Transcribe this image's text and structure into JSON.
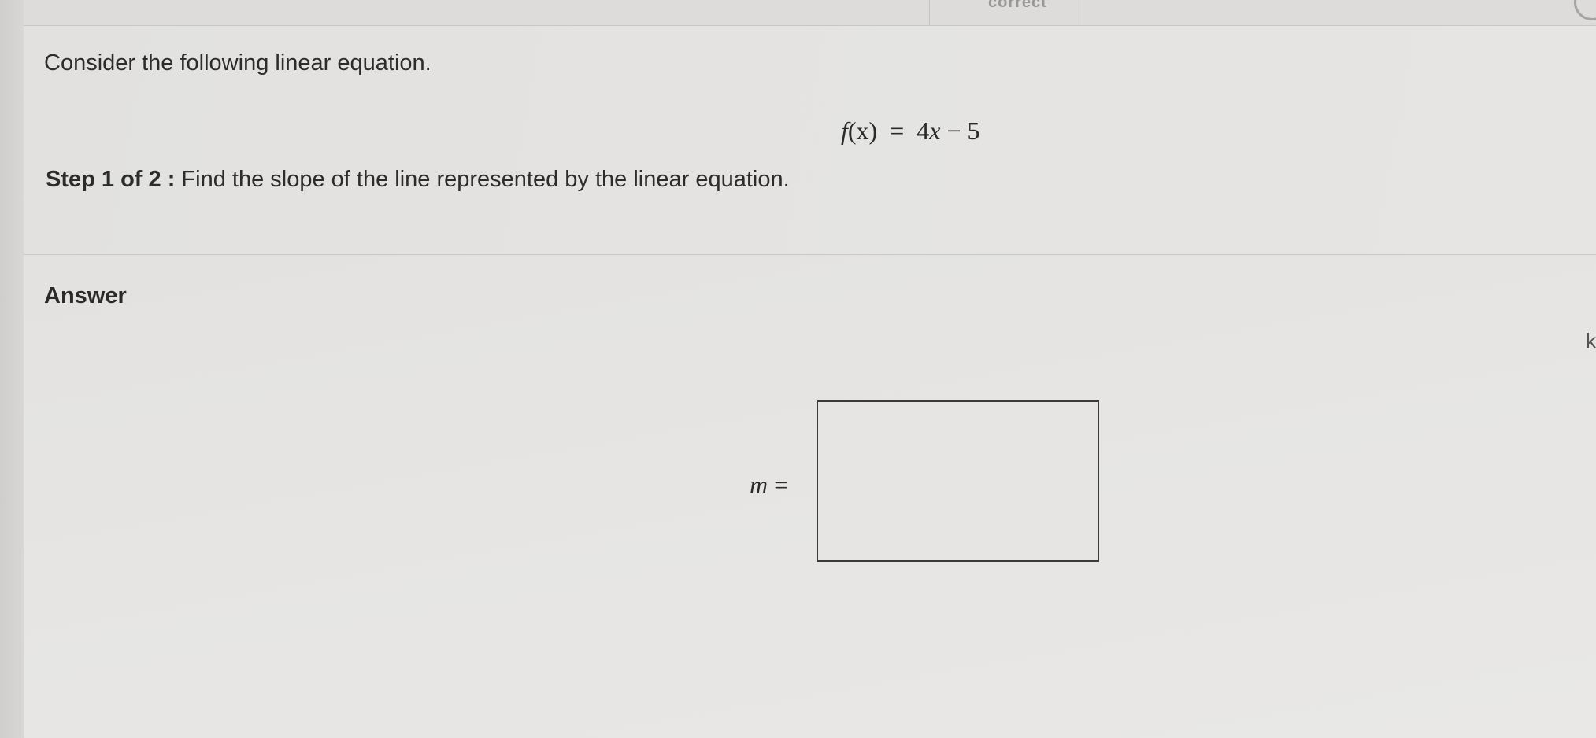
{
  "question": {
    "intro": "Consider the following linear equation.",
    "equation": {
      "func": "f",
      "var": "x",
      "rhs_coef": "4",
      "rhs_var": "x",
      "rhs_rest": " − 5"
    },
    "step": {
      "label": "Step 1 of 2 :",
      "text": "Find the slope of the line represented by the linear equation."
    }
  },
  "answer": {
    "label": "Answer",
    "variable": "m",
    "equals": " =",
    "value": ""
  },
  "header": {
    "cut_label": "correct"
  },
  "colors": {
    "background": "#e4e3e1",
    "text": "#2a2a2a",
    "box_border": "#3a3a3a"
  }
}
